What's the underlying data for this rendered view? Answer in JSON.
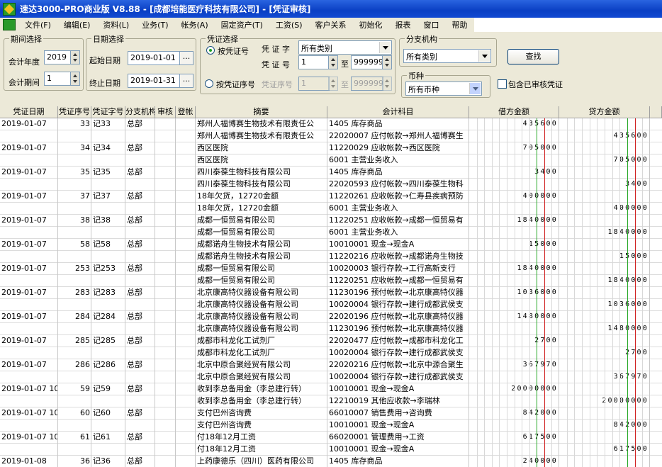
{
  "title": "速达3000-PRO商业版  V8.88 - [成都培能医疗科技有限公司] - [凭证审核]",
  "menu": [
    "文件(F)",
    "编辑(E)",
    "资料(L)",
    "业务(T)",
    "帐务(A)",
    "固定资产(T)",
    "工资(S)",
    "客户关系",
    "初始化",
    "报表",
    "窗口",
    "帮助"
  ],
  "period": {
    "group": "期间选择",
    "year_label": "会计年度",
    "year": "2019",
    "period_label": "会计期间",
    "period": "1"
  },
  "date": {
    "group": "日期选择",
    "start_label": "起始日期",
    "start": "2019-01-01",
    "end_label": "终止日期",
    "end": "2019-01-31",
    "btn": "..."
  },
  "voucher": {
    "group": "凭证选择",
    "opt_no": "按凭证号",
    "opt_seq": "按凭证序号",
    "word_label": "凭 证 字",
    "word": "所有类别",
    "no_label": "凭 证 号",
    "no_from": "1",
    "to": "至",
    "no_to": "999999",
    "seq_label": "凭证序号",
    "seq_from": "1",
    "seq_to": "999999"
  },
  "branch": {
    "group": "分支机构",
    "value": "所有类别"
  },
  "currency": {
    "group": "币种",
    "value": "所有币种"
  },
  "search_btn": "查找",
  "include_audited": "包含已审核凭证",
  "columns": [
    "凭证日期",
    "凭证序号",
    "凭证字号",
    "分支机构",
    "审核",
    "登帐",
    "摘要",
    "会计科目",
    "借方金额",
    "贷方金额"
  ],
  "rows": [
    {
      "date": "2019-01-07",
      "seq": "33",
      "no": "记33",
      "branch": "总部",
      "summary": "郑州人福博赛生物技术有限责任公",
      "account": "1405 库存商品",
      "debit": "435600",
      "credit": ""
    },
    {
      "date": "",
      "seq": "",
      "no": "",
      "branch": "",
      "summary": "郑州人福博赛生物技术有限责任公",
      "account": "22020007 应付帐款→郑州人福博赛生",
      "debit": "",
      "credit": "435600"
    },
    {
      "date": "2019-01-07",
      "seq": "34",
      "no": "记34",
      "branch": "总部",
      "summary": "西区医院",
      "account": "11220029 应收帐款→西区医院",
      "debit": "705000",
      "credit": ""
    },
    {
      "date": "",
      "seq": "",
      "no": "",
      "branch": "",
      "summary": "西区医院",
      "account": "6001 主营业务收入",
      "debit": "",
      "credit": "705000"
    },
    {
      "date": "2019-01-07",
      "seq": "35",
      "no": "记35",
      "branch": "总部",
      "summary": "四川泰葆生物科技有限公司",
      "account": "1405 库存商品",
      "debit": "3400",
      "credit": ""
    },
    {
      "date": "",
      "seq": "",
      "no": "",
      "branch": "",
      "summary": "四川泰葆生物科技有限公司",
      "account": "22020593 应付帐款→四川泰葆生物科",
      "debit": "",
      "credit": "3400"
    },
    {
      "date": "2019-01-07",
      "seq": "37",
      "no": "记37",
      "branch": "总部",
      "summary": "18年欠货，12720金额",
      "account": "11220261 应收帐款→仁寿县疾病预防",
      "debit": "400000",
      "credit": ""
    },
    {
      "date": "",
      "seq": "",
      "no": "",
      "branch": "",
      "summary": "18年欠货，12720金额",
      "account": "6001 主营业务收入",
      "debit": "",
      "credit": "400000"
    },
    {
      "date": "2019-01-07",
      "seq": "38",
      "no": "记38",
      "branch": "总部",
      "summary": "成都一恒贸易有限公司",
      "account": "11220251 应收帐款→成都一恒贸易有",
      "debit": "1840000",
      "credit": ""
    },
    {
      "date": "",
      "seq": "",
      "no": "",
      "branch": "",
      "summary": "成都一恒贸易有限公司",
      "account": "6001 主营业务收入",
      "debit": "",
      "credit": "1840000"
    },
    {
      "date": "2019-01-07",
      "seq": "58",
      "no": "记58",
      "branch": "总部",
      "summary": "成都诺舟生物技术有限公司",
      "account": "10010001 现金→现金A",
      "debit": "15000",
      "credit": ""
    },
    {
      "date": "",
      "seq": "",
      "no": "",
      "branch": "",
      "summary": "成都诺舟生物技术有限公司",
      "account": "11220216 应收帐款→成都诺舟生物技",
      "debit": "",
      "credit": "15000"
    },
    {
      "date": "2019-01-07",
      "seq": "253",
      "no": "记253",
      "branch": "总部",
      "summary": "成都一恒贸易有限公司",
      "account": "10020003 银行存款→工行高新支行",
      "debit": "1840000",
      "credit": ""
    },
    {
      "date": "",
      "seq": "",
      "no": "",
      "branch": "",
      "summary": "成都一恒贸易有限公司",
      "account": "11220251 应收帐款→成都一恒贸易有",
      "debit": "",
      "credit": "1840000"
    },
    {
      "date": "2019-01-07",
      "seq": "283",
      "no": "记283",
      "branch": "总部",
      "summary": "北京康高特仪器设备有限公司",
      "account": "11230196 预付帐款→北京康高特仪器",
      "debit": "1036000",
      "credit": ""
    },
    {
      "date": "",
      "seq": "",
      "no": "",
      "branch": "",
      "summary": "北京康高特仪器设备有限公司",
      "account": "10020004 银行存款→建行成都武侯支",
      "debit": "",
      "credit": "1036000"
    },
    {
      "date": "2019-01-07",
      "seq": "284",
      "no": "记284",
      "branch": "总部",
      "summary": "北京康高特仪器设备有限公司",
      "account": "22020196 应付帐款→北京康高特仪器",
      "debit": "1480000",
      "credit": ""
    },
    {
      "date": "",
      "seq": "",
      "no": "",
      "branch": "",
      "summary": "北京康高特仪器设备有限公司",
      "account": "11230196 预付帐款→北京康高特仪器",
      "debit": "",
      "credit": "1480000"
    },
    {
      "date": "2019-01-07",
      "seq": "285",
      "no": "记285",
      "branch": "总部",
      "summary": "成都市科龙化工试剂厂",
      "account": "22020477 应付帐款→成都市科龙化工",
      "debit": "2700",
      "credit": ""
    },
    {
      "date": "",
      "seq": "",
      "no": "",
      "branch": "",
      "summary": "成都市科龙化工试剂厂",
      "account": "10020004 银行存款→建行成都武侯支",
      "debit": "",
      "credit": "2700"
    },
    {
      "date": "2019-01-07",
      "seq": "286",
      "no": "记286",
      "branch": "总部",
      "summary": "北京中原合聚经贸有限公司",
      "account": "22020216 应付帐款→北京中源合聚生",
      "debit": "367970",
      "credit": ""
    },
    {
      "date": "",
      "seq": "",
      "no": "",
      "branch": "",
      "summary": "北京中原合聚经贸有限公司",
      "account": "10020004 银行存款→建行成都武侯支",
      "debit": "",
      "credit": "367970"
    },
    {
      "date": "2019-01-07 10",
      "seq": "59",
      "no": "记59",
      "branch": "总部",
      "summary": "收到李总备用金（李总建行转）",
      "account": "10010001 现金→现金A",
      "debit": "20000000",
      "credit": ""
    },
    {
      "date": "",
      "seq": "",
      "no": "",
      "branch": "",
      "summary": "收到李总备用金（李总建行转）",
      "account": "12210019 其他应收款→李瑞林",
      "debit": "",
      "credit": "20000000"
    },
    {
      "date": "2019-01-07 10",
      "seq": "60",
      "no": "记60",
      "branch": "总部",
      "summary": "支付巴州咨询费",
      "account": "66010007 销售费用→咨询费",
      "debit": "842000",
      "credit": ""
    },
    {
      "date": "",
      "seq": "",
      "no": "",
      "branch": "",
      "summary": "支付巴州咨询费",
      "account": "10010001 现金→现金A",
      "debit": "",
      "credit": "842000"
    },
    {
      "date": "2019-01-07 10",
      "seq": "61",
      "no": "记61",
      "branch": "总部",
      "summary": "付18年12月工资",
      "account": "66020001 管理费用→工资",
      "debit": "617500",
      "credit": ""
    },
    {
      "date": "",
      "seq": "",
      "no": "",
      "branch": "",
      "summary": "付18年12月工资",
      "account": "10010001 现金→现金A",
      "debit": "",
      "credit": "617500"
    },
    {
      "date": "2019-01-08",
      "seq": "36",
      "no": "记36",
      "branch": "总部",
      "summary": "上药康德乐（四川）医药有限公司",
      "account": "1405 库存商品",
      "debit": "240000",
      "credit": ""
    }
  ]
}
